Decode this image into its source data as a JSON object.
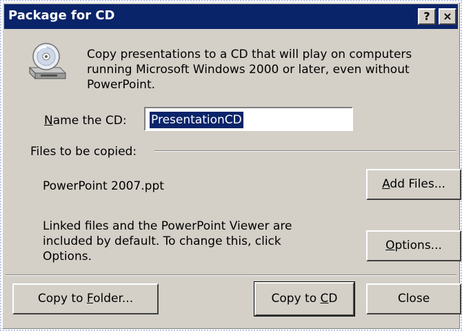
{
  "window": {
    "title": "Package for CD",
    "help_label": "?",
    "close_label": "×"
  },
  "intro": {
    "lines": [
      "Copy presentations to a CD that will play on computers",
      "running Microsoft Windows 2000 or later, even without",
      "PowerPoint."
    ]
  },
  "name": {
    "label_mnemonic": "N",
    "label_rest": "ame the CD:",
    "value": "PresentationCD"
  },
  "files": {
    "section_label": "Files to be copied:",
    "items": [
      "PowerPoint 2007.ppt"
    ],
    "add_files_mnemonic": "A",
    "add_files_rest": "dd Files..."
  },
  "linked": {
    "lines": [
      "Linked files and the PowerPoint Viewer are",
      "included by default. To change this, click",
      "Options."
    ],
    "options_mnemonic": "O",
    "options_rest": "ptions..."
  },
  "footer": {
    "copy_folder_pre": "Copy to ",
    "copy_folder_mnemonic": "F",
    "copy_folder_post": "older...",
    "copy_cd_pre": "Copy to ",
    "copy_cd_mnemonic": "C",
    "copy_cd_post": "D",
    "close_label": "Close"
  },
  "colors": {
    "face": "#d4d0c8",
    "titlebar": "#0a246a",
    "selection": "#0a246a"
  }
}
